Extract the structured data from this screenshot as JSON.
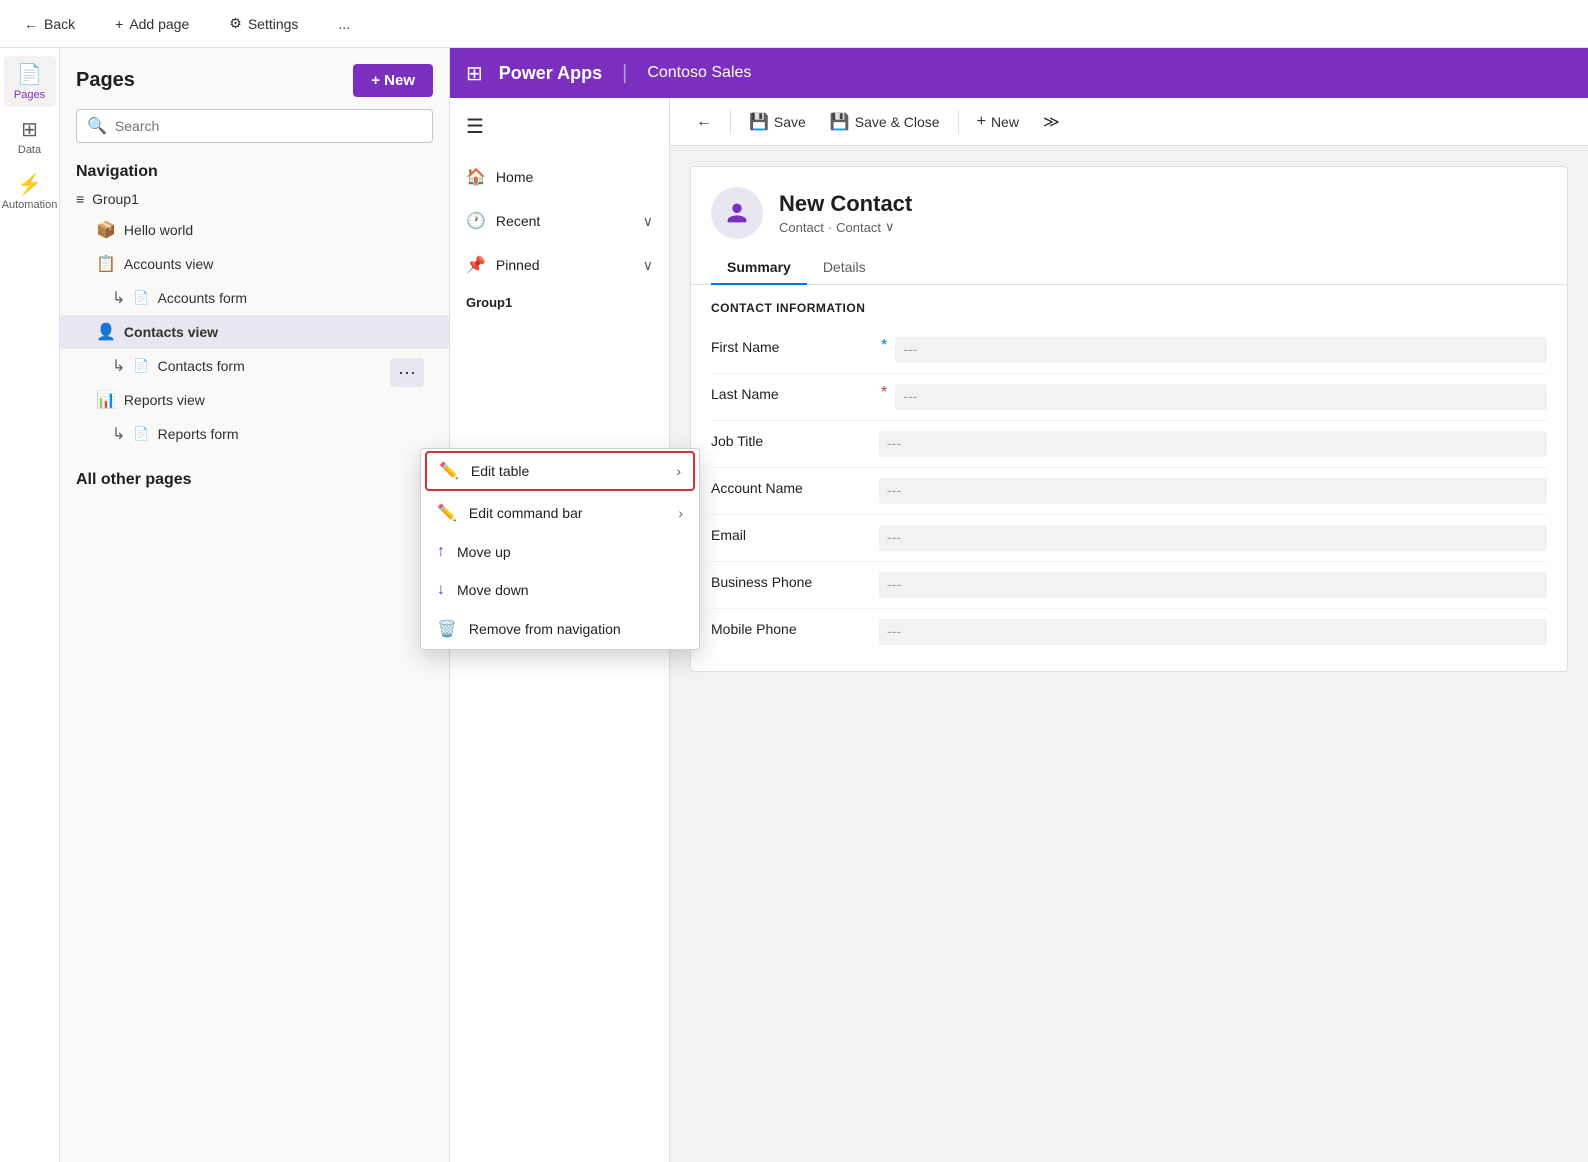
{
  "topbar": {
    "back_label": "Back",
    "add_page_label": "Add page",
    "settings_label": "Settings",
    "more_label": "..."
  },
  "icon_sidebar": {
    "items": [
      {
        "id": "pages",
        "label": "Pages",
        "icon": "📄",
        "active": true
      },
      {
        "id": "data",
        "label": "Data",
        "icon": "⊞"
      },
      {
        "id": "automation",
        "label": "Automation",
        "icon": "⚡"
      }
    ]
  },
  "pages_panel": {
    "title": "Pages",
    "new_button": "+ New",
    "search_placeholder": "Search",
    "navigation_title": "Navigation",
    "nav_group": "Group1",
    "nav_items": [
      {
        "id": "hello-world",
        "label": "Hello world",
        "icon": "📦",
        "active": false
      },
      {
        "id": "accounts-view",
        "label": "Accounts view",
        "icon": "📋",
        "active": false
      },
      {
        "id": "accounts-form",
        "label": "Accounts form",
        "icon": "📄",
        "active": false,
        "indented": true
      },
      {
        "id": "contacts-view",
        "label": "Contacts view",
        "icon": "👤",
        "active": true
      },
      {
        "id": "contacts-form",
        "label": "Contacts form",
        "icon": "📄",
        "active": false,
        "indented": true
      },
      {
        "id": "reports-view",
        "label": "Reports view",
        "icon": "📊",
        "active": false
      },
      {
        "id": "reports-form",
        "label": "Reports form",
        "icon": "📄",
        "active": false,
        "indented": true
      }
    ],
    "all_other_pages_title": "All other pages"
  },
  "context_menu": {
    "items": [
      {
        "id": "edit-table",
        "label": "Edit table",
        "icon": "✏️",
        "has_arrow": true,
        "highlighted": true
      },
      {
        "id": "edit-command-bar",
        "label": "Edit command bar",
        "icon": "✏️",
        "has_arrow": true,
        "highlighted": false
      },
      {
        "id": "move-up",
        "label": "Move up",
        "icon": "↑",
        "has_arrow": false,
        "highlighted": false
      },
      {
        "id": "move-down",
        "label": "Move down",
        "icon": "↓",
        "has_arrow": false,
        "highlighted": false
      },
      {
        "id": "remove-from-navigation",
        "label": "Remove from navigation",
        "icon": "🗑️",
        "has_arrow": false,
        "highlighted": false
      }
    ]
  },
  "app": {
    "grid_icon": "⊞",
    "name": "Power Apps",
    "subtitle": "Contoso Sales",
    "nav_items": [
      {
        "id": "home",
        "label": "Home",
        "icon": "🏠"
      },
      {
        "id": "recent",
        "label": "Recent",
        "icon": "🕐",
        "has_expand": true
      },
      {
        "id": "pinned",
        "label": "Pinned",
        "icon": "📌",
        "has_expand": true
      }
    ],
    "nav_group": "Group1"
  },
  "form": {
    "toolbar": {
      "back_icon": "←",
      "save_label": "Save",
      "save_close_label": "Save & Close",
      "new_label": "New",
      "more_icon": "≫"
    },
    "contact_name": "New Contact",
    "contact_type1": "Contact",
    "contact_type2": "Contact",
    "tabs": [
      {
        "id": "summary",
        "label": "Summary",
        "active": true
      },
      {
        "id": "details",
        "label": "Details",
        "active": false
      }
    ],
    "section_title": "CONTACT INFORMATION",
    "fields": [
      {
        "id": "first-name",
        "label": "First Name",
        "value": "---",
        "required": "blue"
      },
      {
        "id": "last-name",
        "label": "Last Name",
        "value": "---",
        "required": "red"
      },
      {
        "id": "job-title",
        "label": "Job Title",
        "value": "---",
        "required": "none"
      },
      {
        "id": "account-name",
        "label": "Account Name",
        "value": "---",
        "required": "none"
      },
      {
        "id": "email",
        "label": "Email",
        "value": "---",
        "required": "none"
      },
      {
        "id": "business-phone",
        "label": "Business Phone",
        "value": "---",
        "required": "none"
      },
      {
        "id": "mobile-phone",
        "label": "Mobile Phone",
        "value": "---",
        "required": "none"
      }
    ]
  },
  "colors": {
    "purple": "#7B2FBE",
    "blue": "#0078d4",
    "red": "#d13438"
  }
}
